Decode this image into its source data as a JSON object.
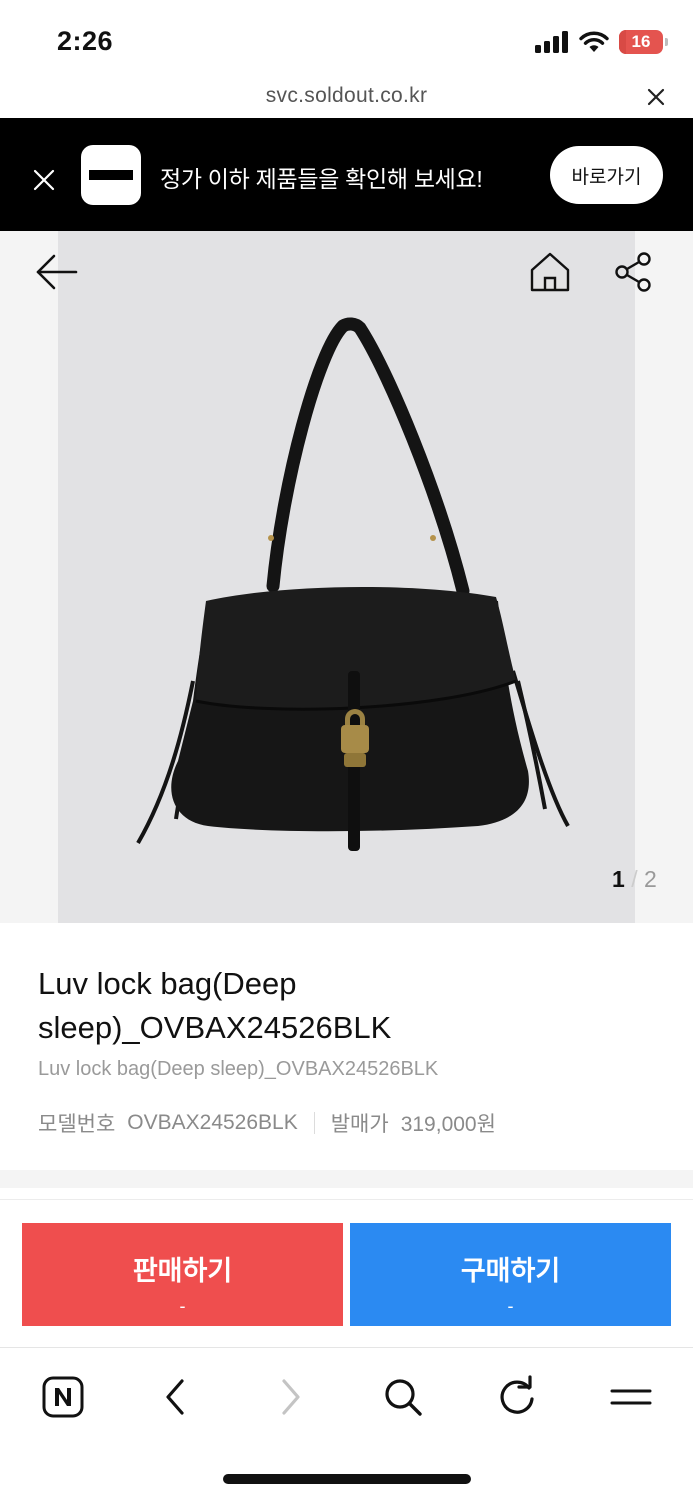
{
  "status_bar": {
    "time": "2:26",
    "battery": "16",
    "battery_level": 0.16,
    "icons": [
      "signal-icon",
      "wifi-icon",
      "battery-icon"
    ]
  },
  "url_bar": {
    "url": "svc.soldout.co.kr"
  },
  "promo": {
    "text": "정가 이하 제품들을 확인해 보세요!",
    "button_label": "바로가기"
  },
  "gallery": {
    "current": "1",
    "separator": "/",
    "total": "2"
  },
  "product": {
    "title": "Luv lock bag(Deep sleep)_OVBAX24526BLK",
    "subtitle": "Luv lock bag(Deep sleep)_OVBAX24526BLK",
    "model_label": "모델번호",
    "model_value": "OVBAX24526BLK",
    "price_label": "발매가",
    "price_value": "319,000원"
  },
  "actions": {
    "sell_label": "판매하기",
    "sell_sub": "-",
    "buy_label": "구매하기",
    "buy_sub": "-"
  },
  "colors": {
    "sell": "#ef4e4e",
    "buy": "#2b8af2",
    "promo_bg": "#000000"
  },
  "toolbar": {
    "icons": [
      "naver-icon",
      "back-icon",
      "forward-icon",
      "search-icon",
      "refresh-icon",
      "menu-icon"
    ]
  }
}
